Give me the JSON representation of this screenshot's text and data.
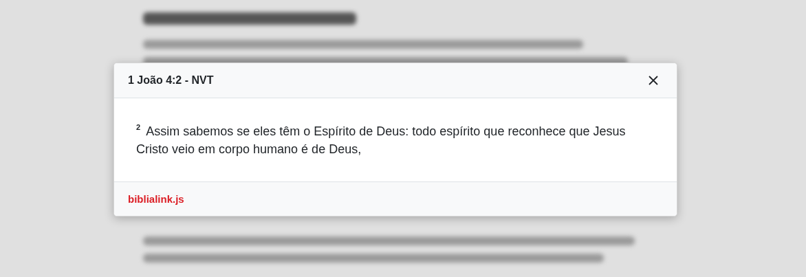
{
  "dialog": {
    "title": "1 João 4:2 - NVT",
    "verse": "$^{2}$ Assim sabemos se eles têm o Espírito de Deus: todo espírito que reconhece que Jesus Cristo veio em corpo humano é de Deus,",
    "footer_link": "biblialink.js"
  }
}
